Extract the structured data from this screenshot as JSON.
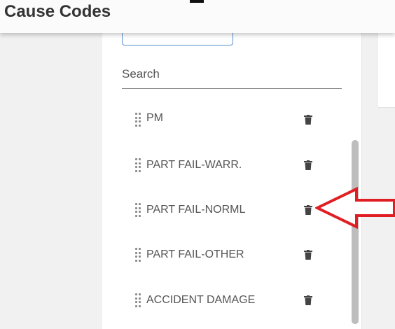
{
  "header": {
    "title": "Cause Codes"
  },
  "search": {
    "label": "Search",
    "value": ""
  },
  "list": {
    "items": [
      {
        "label": "PM"
      },
      {
        "label": "PART FAIL-WARR."
      },
      {
        "label": "PART FAIL-NORML"
      },
      {
        "label": "PART FAIL-OTHER"
      },
      {
        "label": "ACCIDENT DAMAGE"
      }
    ]
  },
  "annotation": {
    "color": "#e01f25"
  },
  "icons": {
    "drag": "drag-handle-icon",
    "delete": "trash-icon"
  }
}
